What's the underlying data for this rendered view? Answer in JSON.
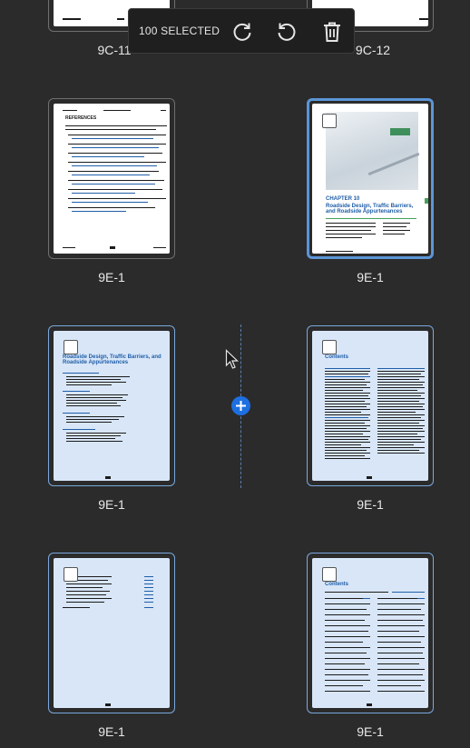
{
  "toolbar": {
    "selected_label": "100 SELECTED",
    "buttons": [
      {
        "icon": "rotate-clockwise-icon"
      },
      {
        "icon": "rotate-counterclockwise-icon"
      },
      {
        "icon": "trash-icon"
      }
    ]
  },
  "pages": [
    {
      "label": "9C-11",
      "selected": false
    },
    {
      "label": "9C-12",
      "selected": false
    },
    {
      "label": "9E-1",
      "selected": false,
      "heading": "REFERENCES"
    },
    {
      "label": "9E-1",
      "selected": true,
      "focused": true,
      "chapter": "CHAPTER 10",
      "title": "Roadside Design, Traffic Barriers, and Roadside Appurtenances"
    },
    {
      "label": "9E-1",
      "selected": true,
      "title": "Roadside Design, Traffic Barriers, and Roadside Appurtenances"
    },
    {
      "label": "9E-1",
      "selected": true,
      "heading": "Contents"
    },
    {
      "label": "9E-1",
      "selected": true
    },
    {
      "label": "9E-1",
      "selected": true,
      "heading": "Contents"
    }
  ],
  "colors": {
    "background": "#2b2b2b",
    "selection_border": "#5b95d6",
    "selected_page": "#d8e6f8",
    "insert_marker": "#1e6fe0"
  }
}
